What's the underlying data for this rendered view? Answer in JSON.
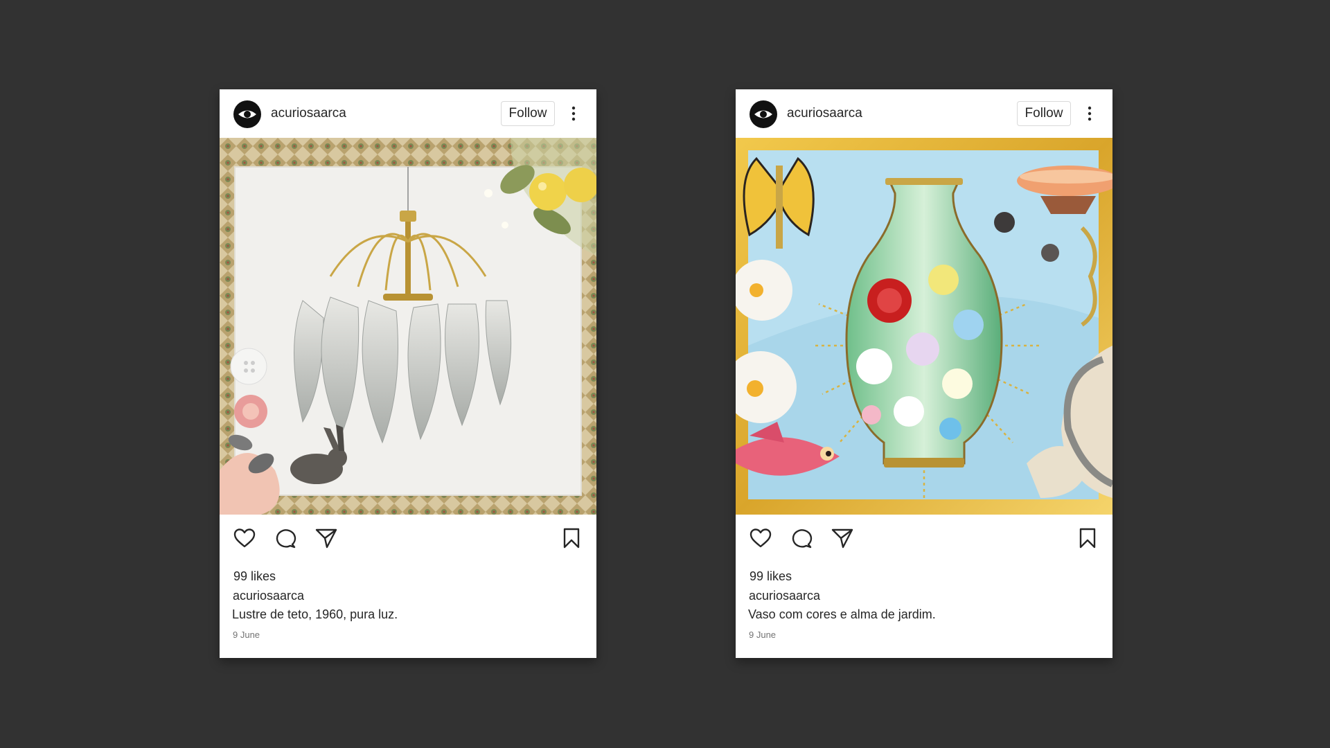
{
  "posts": [
    {
      "username": "acuriosaarca",
      "follow_label": "Follow",
      "likes": "99 likes",
      "caption_user": "acuriosaarca",
      "caption": "Lustre de teto, 1960, pura luz.",
      "date": "9 June",
      "image": "chandelier-collage"
    },
    {
      "username": "acuriosaarca",
      "follow_label": "Follow",
      "likes": "99 likes",
      "caption_user": "acuriosaarca",
      "caption": "Vaso com cores e alma de jardim.",
      "date": "9 June",
      "image": "cloisonne-vase-collage"
    }
  ],
  "icons": {
    "avatar": "eye-logo-icon",
    "more": "more-options-icon",
    "like": "heart-icon",
    "comment": "comment-icon",
    "share": "send-icon",
    "save": "bookmark-icon"
  },
  "colors": {
    "background": "#323232",
    "card": "#ffffff",
    "text": "#262626",
    "muted": "#737373"
  }
}
